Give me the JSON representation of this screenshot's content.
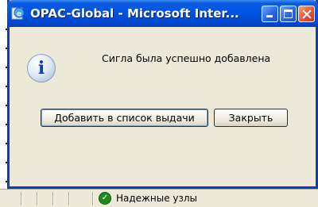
{
  "window": {
    "title": "OPAC-Global - Microsoft Inter..."
  },
  "dialog": {
    "message": "Сигла была успешно добавлена",
    "buttons": {
      "add_label": "Добавить в список выдачи",
      "close_label": "Закрыть"
    }
  },
  "statusbar": {
    "zone_label": "Надежные узлы"
  },
  "icons": {
    "app": "ie-icon",
    "info": "info-icon",
    "status": "check-icon"
  },
  "colors": {
    "titlebar": "#0054e3",
    "dialog_bg": "#ece9d8",
    "close_button": "#e0572f",
    "status_ok": "#1f8a1f"
  }
}
